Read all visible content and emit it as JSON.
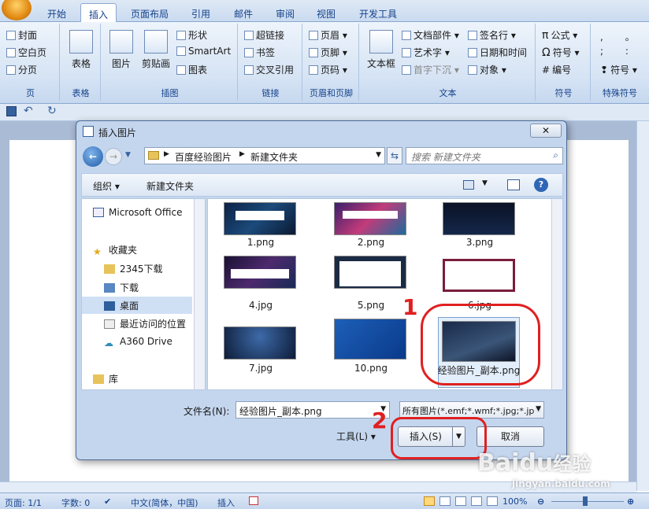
{
  "ribbon_tabs": [
    "开始",
    "插入",
    "页面布局",
    "引用",
    "邮件",
    "审阅",
    "视图",
    "开发工具"
  ],
  "active_tab": "插入",
  "groups": {
    "page": {
      "label": "页",
      "items": [
        "封面",
        "空白页",
        "分页"
      ]
    },
    "table": {
      "label": "表格",
      "button": "表格"
    },
    "illus": {
      "label": "插图",
      "picture": "图片",
      "clipart": "剪贴画",
      "shape": "形状",
      "smartart": "SmartArt",
      "chart": "图表"
    },
    "link": {
      "label": "链接",
      "items": [
        "超链接",
        "书签",
        "交叉引用"
      ]
    },
    "hf": {
      "label": "页眉和页脚",
      "items": [
        "页眉",
        "页脚",
        "页码"
      ]
    },
    "text": {
      "label": "文本",
      "textbox": "文本框",
      "items": [
        "文档部件",
        "艺术字",
        "首字下沉",
        "签名行",
        "日期和时间",
        "对象"
      ]
    },
    "symbol": {
      "label": "符号",
      "items": [
        "公式",
        "符号",
        "编号"
      ]
    },
    "special": {
      "label": "特殊符号",
      "item": "符号"
    }
  },
  "dialog": {
    "title": "插入图片",
    "path": [
      "百度经验图片",
      "新建文件夹"
    ],
    "search_placeholder": "搜索 新建文件夹",
    "organize": "组织",
    "new_folder": "新建文件夹",
    "nav": [
      "Microsoft Office",
      "收藏夹",
      "2345下载",
      "下载",
      "桌面",
      "最近访问的位置",
      "A360 Drive",
      "库"
    ],
    "files": [
      "1.png",
      "2.png",
      "3.png",
      "4.jpg",
      "5.png",
      "6.jpg",
      "7.jpg",
      "10.png",
      "经验图片_副本.png"
    ],
    "filename_label": "文件名(N):",
    "filename_value": "经验图片_副本.png",
    "filetype_value": "所有图片(*.emf;*.wmf;*.jpg;*.jp",
    "tools": "工具(L)",
    "insert": "插入(S)",
    "cancel": "取消"
  },
  "annotations": [
    "1",
    "2"
  ],
  "status": {
    "page": "页面: 1/1",
    "words": "字数: 0",
    "lang": "中文(简体，中国)",
    "mode": "插入",
    "zoom": "100%"
  },
  "watermark": {
    "brand": "Baidu",
    "suffix": "经验",
    "url": "jingyan.baidu.com"
  },
  "colors": {
    "accent": "#15428b",
    "annotation": "#e02020"
  }
}
